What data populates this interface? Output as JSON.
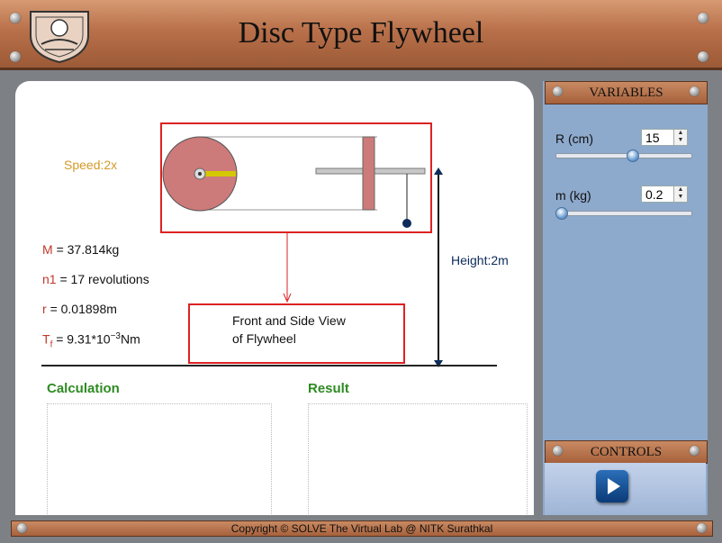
{
  "header": {
    "title": "Disc Type Flywheel"
  },
  "simulation": {
    "speed": "Speed:2x",
    "height_label": "Height:2m",
    "view_caption_line1": "Front and Side View",
    "view_caption_line2": "of Flywheel"
  },
  "readings": {
    "M_label": "M",
    "M_value": "= 37.814kg",
    "n1_label": "n1",
    "n1_value": "= 17 revolutions",
    "r_label": "r",
    "r_value": "= 0.01898m",
    "Tf_label": "T",
    "Tf_sub": "f",
    "Tf_value_pre": "= 9.31*10",
    "Tf_exp": "−3",
    "Tf_unit": "Nm"
  },
  "sections": {
    "calculation": "Calculation",
    "result": "Result"
  },
  "variables": {
    "title": "VARIABLES",
    "R": {
      "label": "R (cm)",
      "value": "15",
      "slider_fraction": 0.57
    },
    "m": {
      "label": "m (kg)",
      "value": "0.2",
      "slider_fraction": 0.0
    }
  },
  "controls": {
    "title": "CONTROLS",
    "play_icon": "play-icon"
  },
  "footer": {
    "copyright": "Copyright © SOLVE The Virtual Lab @ NITK Surathkal"
  },
  "colors": {
    "disc": "#cd7a7a",
    "shaft_marker": "#d4c800",
    "callout_border": "#dd2222",
    "readings_label": "#c0392b",
    "section_heading": "#2e8b23"
  }
}
